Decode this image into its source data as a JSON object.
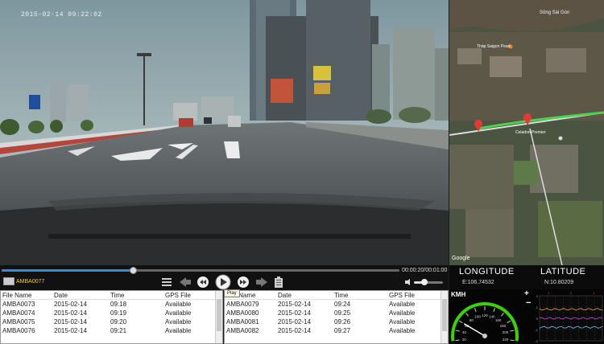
{
  "video": {
    "timestamp": "2015-02-14 09:22:02",
    "time_readout": "00:00:20/00:01:00",
    "progress": 0.33
  },
  "player": {
    "current_file": "AMBA0077",
    "tooltip": "Play",
    "volume": 0.35,
    "controls": [
      "list-icon",
      "previous-icon",
      "rewind-icon",
      "play-icon",
      "fast-forward-icon",
      "next-icon",
      "battery-icon"
    ]
  },
  "table_left": {
    "columns": [
      "File Name",
      "Date",
      "Time",
      "GPS File"
    ],
    "rows": [
      [
        "AMBA0073",
        "2015-02-14",
        "09:18",
        "Available"
      ],
      [
        "AMBA0074",
        "2015-02-14",
        "09:19",
        "Available"
      ],
      [
        "AMBA0075",
        "2015-02-14",
        "09:20",
        "Available"
      ],
      [
        "AMBA0076",
        "2015-02-14",
        "09:21",
        "Available"
      ]
    ]
  },
  "table_right": {
    "columns": [
      "File Name",
      "Date",
      "Time",
      "GPS File"
    ],
    "rows": [
      [
        "AMBA0079",
        "2015-02-14",
        "09:24",
        "Available"
      ],
      [
        "AMBA0080",
        "2015-02-14",
        "09:25",
        "Available"
      ],
      [
        "AMBA0081",
        "2015-02-14",
        "09:26",
        "Available"
      ],
      [
        "AMBA0082",
        "2015-02-14",
        "09:27",
        "Available"
      ]
    ]
  },
  "map": {
    "river_label": "Sông Sài Gòn",
    "places": [
      "Tháp Saigon Pearl",
      "Celadon Premier"
    ],
    "google_label": "Google"
  },
  "coords": {
    "longitude_label": "LONGITUDE",
    "latitude_label": "LATITUDE",
    "longitude": "E:106.74532",
    "latitude": "N:10.80209"
  },
  "gauge": {
    "label": "KMH",
    "ticks": [
      "20",
      "40",
      "60",
      "80",
      "100",
      "120",
      "140",
      "160",
      "180",
      "200",
      "220"
    ],
    "needle_value": 0.2
  },
  "graph": {
    "plus": "+",
    "minus": "−",
    "y_labels": [
      "2",
      "1",
      "0",
      "-1",
      "-2"
    ],
    "x_labels": [
      "1",
      "2",
      "1"
    ]
  },
  "colors": {
    "accent": "#2f8fd6",
    "file_label": "#f5d000",
    "route": "#4cd24c",
    "marker": "#e53935",
    "gauge_green": "#39d400"
  }
}
